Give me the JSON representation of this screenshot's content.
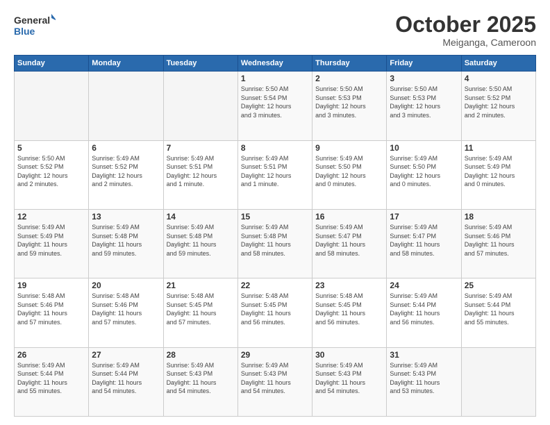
{
  "header": {
    "logo_general": "General",
    "logo_blue": "Blue",
    "month": "October 2025",
    "location": "Meiganga, Cameroon"
  },
  "weekdays": [
    "Sunday",
    "Monday",
    "Tuesday",
    "Wednesday",
    "Thursday",
    "Friday",
    "Saturday"
  ],
  "weeks": [
    [
      {
        "day": "",
        "info": ""
      },
      {
        "day": "",
        "info": ""
      },
      {
        "day": "",
        "info": ""
      },
      {
        "day": "1",
        "info": "Sunrise: 5:50 AM\nSunset: 5:54 PM\nDaylight: 12 hours\nand 3 minutes."
      },
      {
        "day": "2",
        "info": "Sunrise: 5:50 AM\nSunset: 5:53 PM\nDaylight: 12 hours\nand 3 minutes."
      },
      {
        "day": "3",
        "info": "Sunrise: 5:50 AM\nSunset: 5:53 PM\nDaylight: 12 hours\nand 3 minutes."
      },
      {
        "day": "4",
        "info": "Sunrise: 5:50 AM\nSunset: 5:52 PM\nDaylight: 12 hours\nand 2 minutes."
      }
    ],
    [
      {
        "day": "5",
        "info": "Sunrise: 5:50 AM\nSunset: 5:52 PM\nDaylight: 12 hours\nand 2 minutes."
      },
      {
        "day": "6",
        "info": "Sunrise: 5:49 AM\nSunset: 5:52 PM\nDaylight: 12 hours\nand 2 minutes."
      },
      {
        "day": "7",
        "info": "Sunrise: 5:49 AM\nSunset: 5:51 PM\nDaylight: 12 hours\nand 1 minute."
      },
      {
        "day": "8",
        "info": "Sunrise: 5:49 AM\nSunset: 5:51 PM\nDaylight: 12 hours\nand 1 minute."
      },
      {
        "day": "9",
        "info": "Sunrise: 5:49 AM\nSunset: 5:50 PM\nDaylight: 12 hours\nand 0 minutes."
      },
      {
        "day": "10",
        "info": "Sunrise: 5:49 AM\nSunset: 5:50 PM\nDaylight: 12 hours\nand 0 minutes."
      },
      {
        "day": "11",
        "info": "Sunrise: 5:49 AM\nSunset: 5:49 PM\nDaylight: 12 hours\nand 0 minutes."
      }
    ],
    [
      {
        "day": "12",
        "info": "Sunrise: 5:49 AM\nSunset: 5:49 PM\nDaylight: 11 hours\nand 59 minutes."
      },
      {
        "day": "13",
        "info": "Sunrise: 5:49 AM\nSunset: 5:48 PM\nDaylight: 11 hours\nand 59 minutes."
      },
      {
        "day": "14",
        "info": "Sunrise: 5:49 AM\nSunset: 5:48 PM\nDaylight: 11 hours\nand 59 minutes."
      },
      {
        "day": "15",
        "info": "Sunrise: 5:49 AM\nSunset: 5:48 PM\nDaylight: 11 hours\nand 58 minutes."
      },
      {
        "day": "16",
        "info": "Sunrise: 5:49 AM\nSunset: 5:47 PM\nDaylight: 11 hours\nand 58 minutes."
      },
      {
        "day": "17",
        "info": "Sunrise: 5:49 AM\nSunset: 5:47 PM\nDaylight: 11 hours\nand 58 minutes."
      },
      {
        "day": "18",
        "info": "Sunrise: 5:49 AM\nSunset: 5:46 PM\nDaylight: 11 hours\nand 57 minutes."
      }
    ],
    [
      {
        "day": "19",
        "info": "Sunrise: 5:48 AM\nSunset: 5:46 PM\nDaylight: 11 hours\nand 57 minutes."
      },
      {
        "day": "20",
        "info": "Sunrise: 5:48 AM\nSunset: 5:46 PM\nDaylight: 11 hours\nand 57 minutes."
      },
      {
        "day": "21",
        "info": "Sunrise: 5:48 AM\nSunset: 5:45 PM\nDaylight: 11 hours\nand 57 minutes."
      },
      {
        "day": "22",
        "info": "Sunrise: 5:48 AM\nSunset: 5:45 PM\nDaylight: 11 hours\nand 56 minutes."
      },
      {
        "day": "23",
        "info": "Sunrise: 5:48 AM\nSunset: 5:45 PM\nDaylight: 11 hours\nand 56 minutes."
      },
      {
        "day": "24",
        "info": "Sunrise: 5:49 AM\nSunset: 5:44 PM\nDaylight: 11 hours\nand 56 minutes."
      },
      {
        "day": "25",
        "info": "Sunrise: 5:49 AM\nSunset: 5:44 PM\nDaylight: 11 hours\nand 55 minutes."
      }
    ],
    [
      {
        "day": "26",
        "info": "Sunrise: 5:49 AM\nSunset: 5:44 PM\nDaylight: 11 hours\nand 55 minutes."
      },
      {
        "day": "27",
        "info": "Sunrise: 5:49 AM\nSunset: 5:44 PM\nDaylight: 11 hours\nand 54 minutes."
      },
      {
        "day": "28",
        "info": "Sunrise: 5:49 AM\nSunset: 5:43 PM\nDaylight: 11 hours\nand 54 minutes."
      },
      {
        "day": "29",
        "info": "Sunrise: 5:49 AM\nSunset: 5:43 PM\nDaylight: 11 hours\nand 54 minutes."
      },
      {
        "day": "30",
        "info": "Sunrise: 5:49 AM\nSunset: 5:43 PM\nDaylight: 11 hours\nand 54 minutes."
      },
      {
        "day": "31",
        "info": "Sunrise: 5:49 AM\nSunset: 5:43 PM\nDaylight: 11 hours\nand 53 minutes."
      },
      {
        "day": "",
        "info": ""
      }
    ]
  ]
}
